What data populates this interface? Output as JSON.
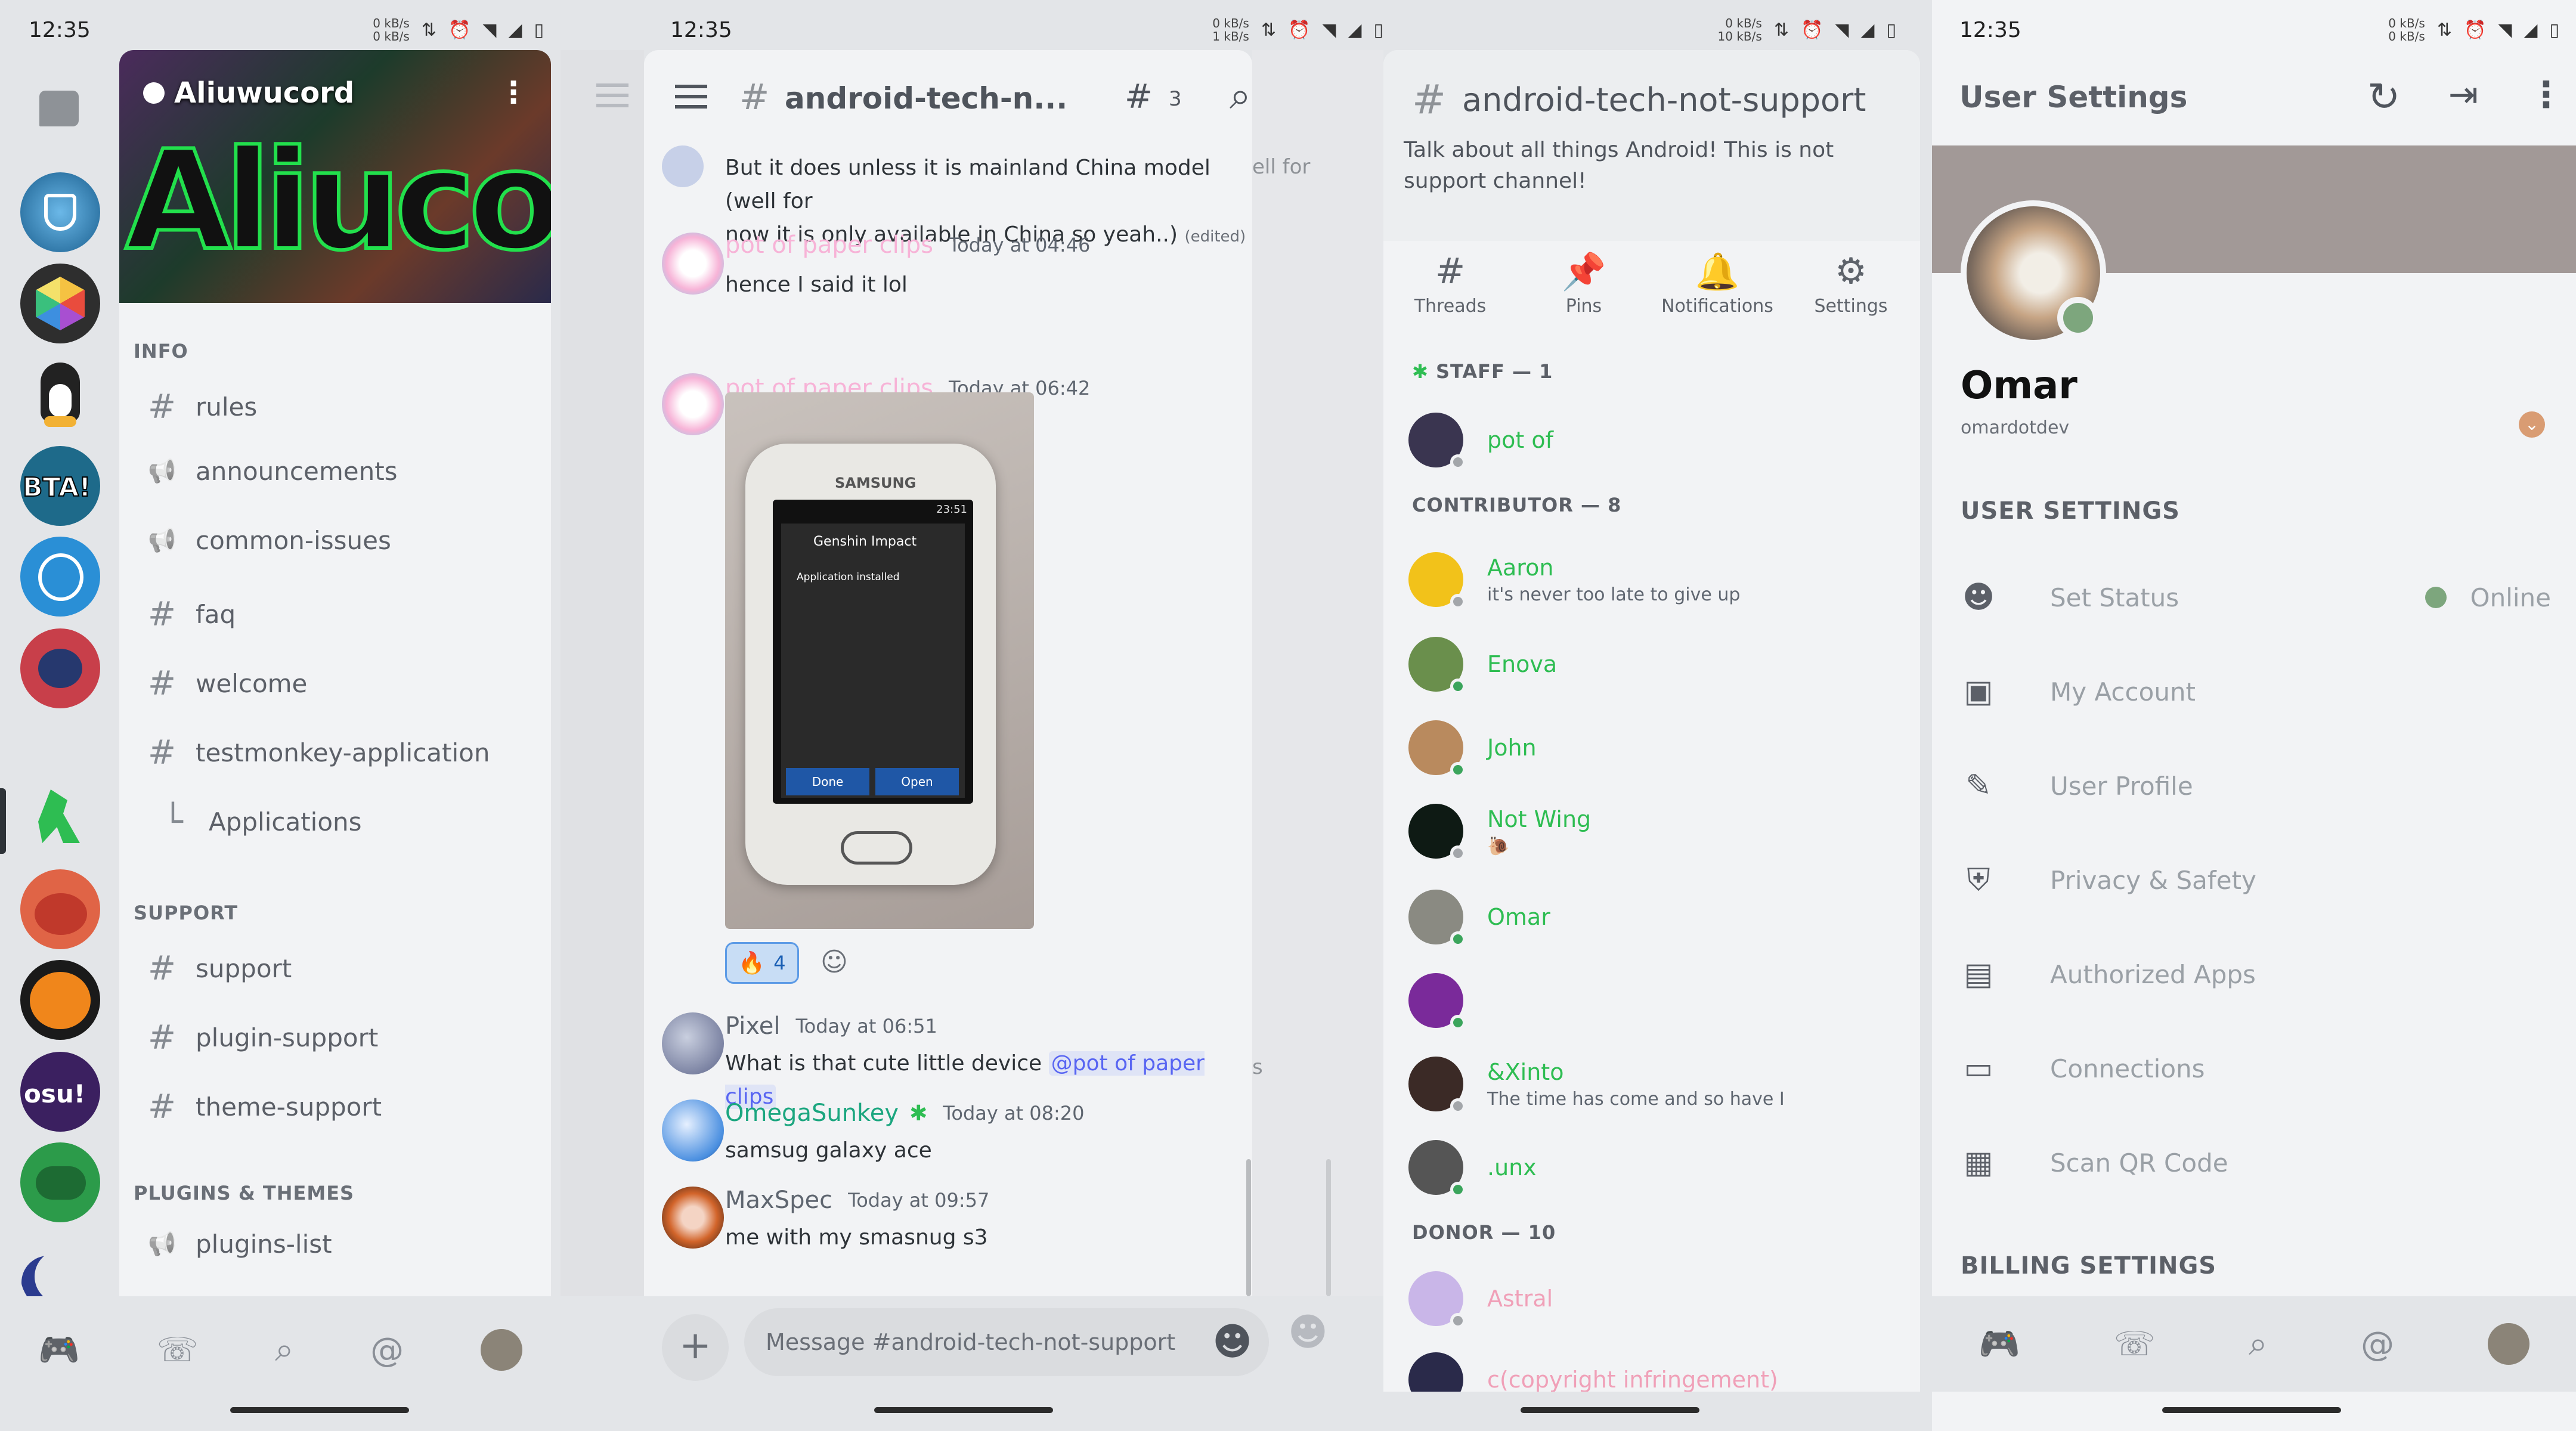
{
  "status": {
    "time": "12:35",
    "kbs_top_1": "0 kB/s",
    "kbs_bottom_1": "0 kB/s",
    "kbs_top_2": "0 kB/s",
    "kbs_bottom_2": "1 kB/s",
    "kbs_top_3": "0 kB/s",
    "kbs_bottom_3": "10 kB/s",
    "kbs_top_4": "0 kB/s",
    "kbs_bottom_4": "0 kB/s"
  },
  "server": {
    "name": "Aliuwucord",
    "banner_text": "Aliucord",
    "categories": [
      {
        "label": "INFO",
        "channels": [
          {
            "icon": "hash",
            "name": "rules"
          },
          {
            "icon": "megaphone",
            "name": "announcements"
          },
          {
            "icon": "megaphone",
            "name": "common-issues"
          },
          {
            "icon": "hash",
            "name": "faq"
          },
          {
            "icon": "hash",
            "name": "welcome"
          },
          {
            "icon": "hash-thread",
            "name": "testmonkey-application"
          },
          {
            "icon": "thread",
            "name": "Applications"
          }
        ]
      },
      {
        "label": "SUPPORT",
        "channels": [
          {
            "icon": "hash-thread",
            "name": "support"
          },
          {
            "icon": "hash",
            "name": "plugin-support"
          },
          {
            "icon": "hash",
            "name": "theme-support"
          }
        ]
      },
      {
        "label": "PLUGINS & THEMES",
        "channels": [
          {
            "icon": "megaphone",
            "name": "plugins-list"
          }
        ]
      }
    ]
  },
  "chat": {
    "channel": "android-tech-n...",
    "thread_count": "3",
    "side_text": "ell for",
    "side_text2": "s",
    "messages": [
      {
        "text1": "But it does unless it is mainland China model (well for",
        "text2": "now it is only available in China so yeah..)",
        "edited": "(edited)"
      },
      {
        "user": "pot of paper clips",
        "time": "Today at 04:46",
        "text": "hence I said it lol"
      },
      {
        "user": "pot of paper clips",
        "time": "Today at 06:42",
        "image_title": "Genshin Impact",
        "image_sub": "Application installed",
        "image_brand": "SAMSUNG",
        "image_clock": "23:51",
        "image_done": "Done",
        "image_open": "Open"
      },
      {
        "reaction_emoji": "🔥",
        "reaction_count": "4"
      },
      {
        "user": "Pixel",
        "time": "Today at 06:51",
        "text": "What is that cute little device",
        "mention": "@pot of paper clips"
      },
      {
        "user": "OmegaSunkey",
        "time": "Today at 08:20",
        "text": "samsug galaxy ace"
      },
      {
        "user": "MaxSpec",
        "time": "Today at 09:57",
        "text": "me with my smasnug s3"
      }
    ],
    "input_placeholder": "Message #android-tech-not-support"
  },
  "channel_info": {
    "title": "android-tech-not-support",
    "topic": "Talk about all things Android! This is not support channel!",
    "tabs": [
      "Threads",
      "Pins",
      "Notifications",
      "Settings"
    ],
    "groups": [
      {
        "label": "STAFF — 1",
        "members": [
          {
            "name": "pot of",
            "sub": ""
          }
        ]
      },
      {
        "label": "CONTRIBUTOR — 8",
        "members": [
          {
            "name": "Aaron",
            "sub": "it's never too late to give up"
          },
          {
            "name": "Enova",
            "sub": ""
          },
          {
            "name": "John",
            "sub": ""
          },
          {
            "name": "Not Wing",
            "sub": "🐌"
          },
          {
            "name": "Omar",
            "sub": ""
          },
          {
            "name": "",
            "sub": ""
          },
          {
            "name": "&Xinto",
            "sub": "The time has come and so have I"
          },
          {
            "name": ".unx",
            "sub": ""
          }
        ]
      },
      {
        "label": "DONOR — 10",
        "members": [
          {
            "name": "Astral",
            "sub": ""
          },
          {
            "name": "c(copyright infringement)",
            "sub": ""
          }
        ]
      }
    ]
  },
  "settings": {
    "title": "User Settings",
    "display_name": "Omar",
    "username": "omardotdev",
    "section1": "USER SETTINGS",
    "rows": [
      {
        "icon": "status-icon",
        "label": "Set Status",
        "value": "Online"
      },
      {
        "icon": "account-icon",
        "label": "My Account"
      },
      {
        "icon": "pencil-icon",
        "label": "User Profile"
      },
      {
        "icon": "shield-icon",
        "label": "Privacy & Safety"
      },
      {
        "icon": "apps-icon",
        "label": "Authorized Apps"
      },
      {
        "icon": "devices-icon",
        "label": "Connections"
      },
      {
        "icon": "qr-icon",
        "label": "Scan QR Code"
      }
    ],
    "section2": "BILLING SETTINGS",
    "banner_color": "#a29997"
  }
}
